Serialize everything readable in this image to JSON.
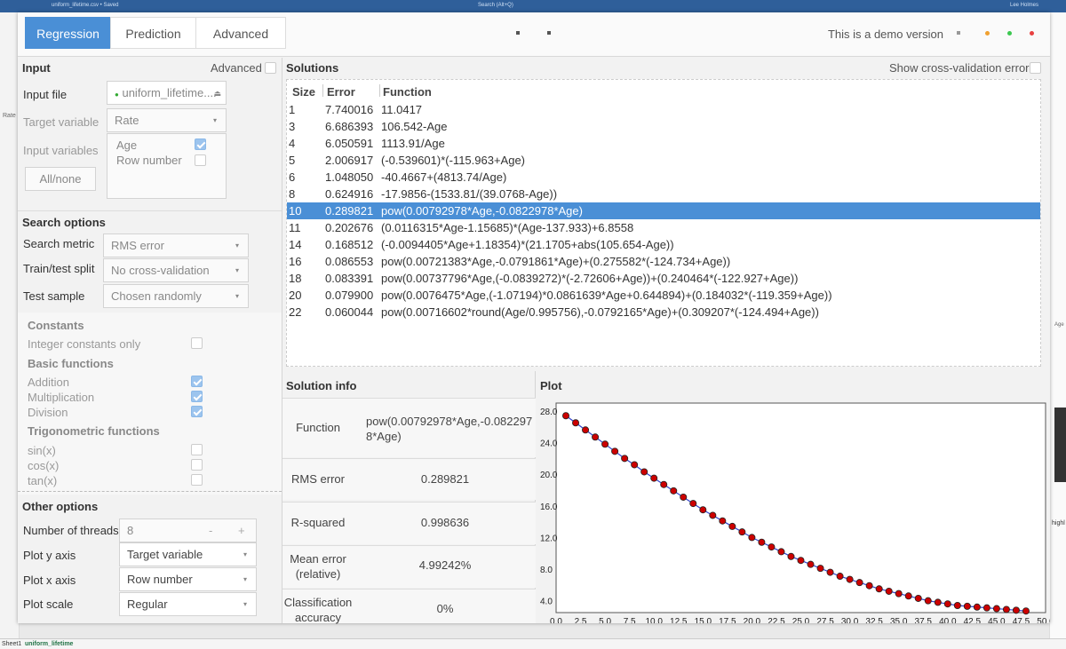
{
  "window": {
    "file_title": "uniform_lifetime.csv • Saved",
    "search": "Search (Alt+Q)",
    "user": "Lee Holmes"
  },
  "sheet": {
    "tab": "Sheet1",
    "active_tab": "uniform_lifetime",
    "col_label": "Rate",
    "right_axis_label": "Age",
    "right_high": "highl"
  },
  "tabs": [
    "Regression",
    "Prediction",
    "Advanced"
  ],
  "demo_text": "This is a demo version",
  "input": {
    "header": "Input",
    "advanced_label": "Advanced",
    "file_label": "Input file",
    "file_value": "uniform_lifetime....",
    "target_label": "Target variable",
    "target_value": "Rate",
    "vars_label": "Input variables",
    "vars": [
      {
        "name": "Age",
        "checked": true
      },
      {
        "name": "Row number",
        "checked": false
      }
    ],
    "all_none": "All/none"
  },
  "search": {
    "header": "Search options",
    "metric_label": "Search metric",
    "metric_value": "RMS error",
    "split_label": "Train/test split",
    "split_value": "No cross-validation",
    "sample_label": "Test sample",
    "sample_value": "Chosen randomly"
  },
  "constants": {
    "header": "Constants",
    "integer_only": "Integer constants only"
  },
  "basic": {
    "header": "Basic functions",
    "items": [
      "Addition",
      "Multiplication",
      "Division"
    ]
  },
  "trig": {
    "header": "Trigonometric functions",
    "items": [
      "sin(x)",
      "cos(x)",
      "tan(x)"
    ]
  },
  "other": {
    "header": "Other options",
    "threads_label": "Number of threads",
    "threads_value": "8",
    "yaxis_label": "Plot y axis",
    "yaxis_value": "Target variable",
    "xaxis_label": "Plot x axis",
    "xaxis_value": "Row number",
    "scale_label": "Plot scale",
    "scale_value": "Regular"
  },
  "solutions": {
    "header": "Solutions",
    "cv_label": "Show cross-validation error",
    "columns": [
      "Size",
      "Error",
      "Function"
    ],
    "selected_index": 6,
    "rows": [
      [
        "1",
        "7.740016",
        "11.0417"
      ],
      [
        "3",
        "6.686393",
        "106.542-Age"
      ],
      [
        "4",
        "6.050591",
        "1113.91/Age"
      ],
      [
        "5",
        "2.006917",
        "(-0.539601)*(-115.963+Age)"
      ],
      [
        "6",
        "1.048050",
        "-40.4667+(4813.74/Age)"
      ],
      [
        "8",
        "0.624916",
        "-17.9856-(1533.81/(39.0768-Age))"
      ],
      [
        "10",
        "0.289821",
        "pow(0.00792978*Age,-0.0822978*Age)"
      ],
      [
        "11",
        "0.202676",
        "(0.0116315*Age-1.15685)*(Age-137.933)+6.8558"
      ],
      [
        "14",
        "0.168512",
        "(-0.0094405*Age+1.18354)*(21.1705+abs(105.654-Age))"
      ],
      [
        "16",
        "0.086553",
        "pow(0.00721383*Age,-0.0791861*Age)+(0.275582*(-124.734+Age))"
      ],
      [
        "18",
        "0.083391",
        "pow(0.00737796*Age,(-0.0839272)*(-2.72606+Age))+(0.240464*(-122.927+Age))"
      ],
      [
        "20",
        "0.079900",
        "pow(0.0076475*Age,(-1.07194)*0.0861639*Age+0.644894)+(0.184032*(-119.359+Age))"
      ],
      [
        "22",
        "0.060044",
        "pow(0.00716602*round(Age/0.995756),-0.0792165*Age)+(0.309207*(-124.494+Age))"
      ]
    ]
  },
  "solution_info": {
    "header": "Solution info",
    "function_label": "Function",
    "function_value": "pow(0.00792978*Age,-0.082297 8*Age)",
    "rms_label": "RMS error",
    "rms_value": "0.289821",
    "r2_label": "R-squared",
    "r2_value": "0.998636",
    "mean_label": "Mean error (relative)",
    "mean_value": "4.99242%",
    "class_label": "Classification accuracy",
    "class_value": "0%"
  },
  "plot": {
    "header": "Plot"
  },
  "chart_data": {
    "type": "scatter",
    "xlim": [
      0,
      50
    ],
    "ylim": [
      2.5,
      29
    ],
    "x_ticks": [
      "0.0",
      "2.5",
      "5.0",
      "7.5",
      "10.0",
      "12.5",
      "15.0",
      "17.5",
      "20.0",
      "22.5",
      "25.0",
      "27.5",
      "30.0",
      "32.5",
      "35.0",
      "37.5",
      "40.0",
      "42.5",
      "45.0",
      "47.5",
      "50.0"
    ],
    "y_ticks": [
      "4.0",
      "8.0",
      "12.0",
      "16.0",
      "20.0",
      "24.0",
      "28.0"
    ],
    "x_start": 1,
    "x": [
      1,
      2,
      3,
      4,
      5,
      6,
      7,
      8,
      9,
      10,
      11,
      12,
      13,
      14,
      15,
      16,
      17,
      18,
      19,
      20,
      21,
      22,
      23,
      24,
      25,
      26,
      27,
      28,
      29,
      30,
      31,
      32,
      33,
      34,
      35,
      36,
      37,
      38,
      39,
      40,
      41,
      42,
      43,
      44,
      45,
      46,
      47,
      48
    ],
    "y": [
      27.4,
      26.5,
      25.6,
      24.7,
      23.8,
      22.9,
      22.0,
      21.2,
      20.3,
      19.5,
      18.7,
      17.9,
      17.1,
      16.3,
      15.5,
      14.8,
      14.1,
      13.4,
      12.7,
      12.0,
      11.4,
      10.8,
      10.2,
      9.6,
      9.1,
      8.6,
      8.1,
      7.6,
      7.1,
      6.7,
      6.3,
      5.9,
      5.5,
      5.2,
      4.9,
      4.6,
      4.3,
      4.0,
      3.8,
      3.6,
      3.4,
      3.3,
      3.2,
      3.1,
      3.0,
      2.9,
      2.8,
      2.7
    ],
    "point_color": "#cc0000",
    "line_color": "#3344cc"
  }
}
